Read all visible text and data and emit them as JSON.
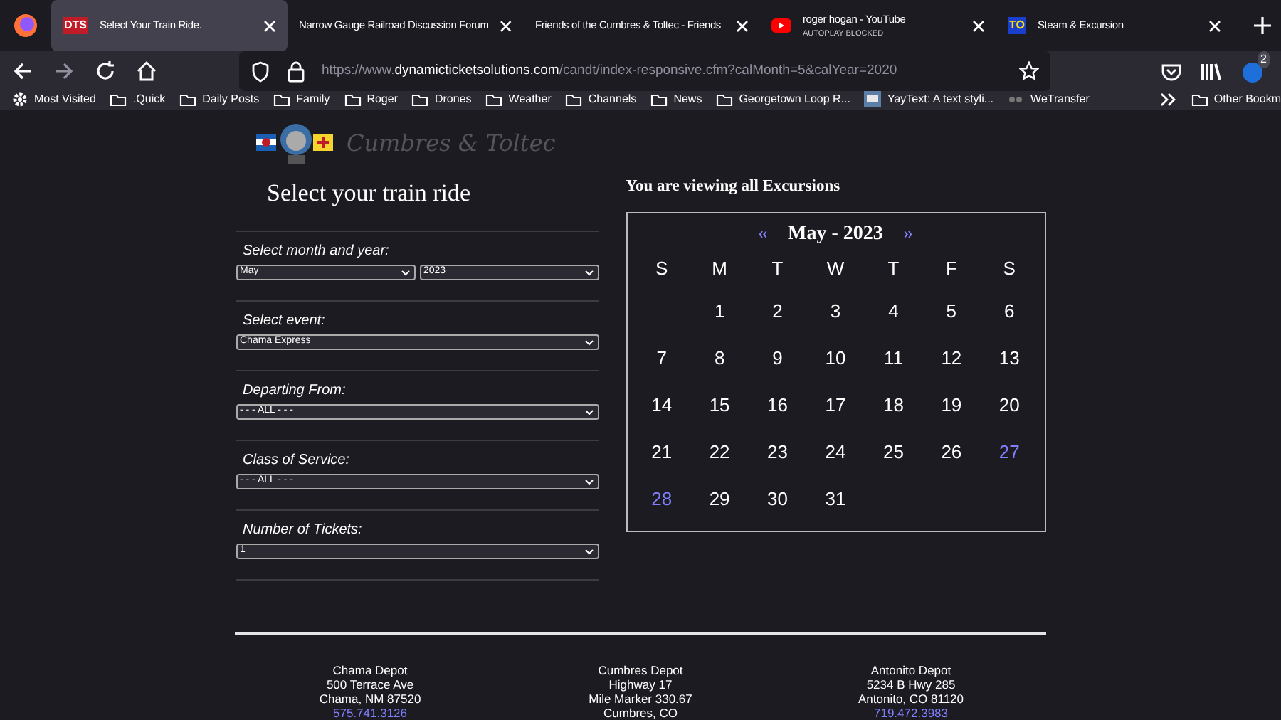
{
  "tabs": [
    {
      "kind": "text-icon",
      "favicon": "DTS",
      "title": "Select Your Train Ride.",
      "selected": true
    },
    {
      "kind": "plain",
      "title": "Narrow Gauge Railroad Discussion Forum",
      "selected": false
    },
    {
      "kind": "plain",
      "title": "Friends of the Cumbres & Toltec - Friends",
      "selected": false
    },
    {
      "kind": "video",
      "title": "roger hogan - YouTube",
      "subtitle": "AUTOPLAY BLOCKED",
      "selected": false
    },
    {
      "kind": "text-icon",
      "favicon": "TO",
      "title": "Steam & Excursion",
      "selected": false
    }
  ],
  "address_bar": {
    "prefix": "https://www.",
    "domain": "dynamicticketsolutions.com",
    "path": "/candt/index-responsive.cfm?calMonth=5&calYear=2020"
  },
  "toolbar": {
    "extension_badge": "2"
  },
  "bookmarks": [
    {
      "kind": "gear",
      "label": "Most Visited"
    },
    {
      "kind": "folder",
      "label": ".Quick"
    },
    {
      "kind": "folder",
      "label": "Daily Posts"
    },
    {
      "kind": "folder",
      "label": "Family"
    },
    {
      "kind": "folder",
      "label": "Roger"
    },
    {
      "kind": "folder",
      "label": "Drones"
    },
    {
      "kind": "folder",
      "label": "Weather"
    },
    {
      "kind": "folder",
      "label": "Channels"
    },
    {
      "kind": "folder",
      "label": "News"
    },
    {
      "kind": "folder",
      "label": "Georgetown Loop R..."
    },
    {
      "kind": "site",
      "label": "YayText: A text styli..."
    },
    {
      "kind": "dots",
      "label": "WeTransfer"
    }
  ],
  "other_bookmarks": "Other Bookm",
  "page": {
    "logo_text": "Cumbres & Toltec",
    "title": "Select your train ride",
    "fields": [
      {
        "label": "Select month and year:",
        "selects": [
          "May",
          "2023"
        ]
      },
      {
        "label": "Select event:",
        "selects": [
          "Chama Express"
        ]
      },
      {
        "label": "Departing From:",
        "selects": [
          "- - - ALL - - -"
        ]
      },
      {
        "label": "Class of Service:",
        "selects": [
          "- - - ALL - - -"
        ]
      },
      {
        "label": "Number of Tickets:",
        "selects": [
          "1"
        ]
      }
    ],
    "viewing": "You are viewing all Excursions",
    "calendar": {
      "prev": "«",
      "title": "May - 2023",
      "next": "»",
      "weekdays": [
        "S",
        "M",
        "T",
        "W",
        "T",
        "F",
        "S"
      ],
      "weeks": [
        [
          {
            "day": "1",
            "available": false
          },
          {
            "day": "2",
            "available": false
          },
          {
            "day": "3",
            "available": false
          },
          {
            "day": "4",
            "available": false
          },
          {
            "day": "5",
            "available": false
          },
          {
            "day": "6",
            "available": false
          }
        ],
        [
          {
            "day": "7",
            "available": false
          },
          {
            "day": "8",
            "available": false
          },
          {
            "day": "9",
            "available": false
          },
          {
            "day": "10",
            "available": false
          },
          {
            "day": "11",
            "available": false
          },
          {
            "day": "12",
            "available": false
          },
          {
            "day": "13",
            "available": false
          }
        ],
        [
          {
            "day": "14",
            "available": false
          },
          {
            "day": "15",
            "available": false
          },
          {
            "day": "16",
            "available": false
          },
          {
            "day": "17",
            "available": false
          },
          {
            "day": "18",
            "available": false
          },
          {
            "day": "19",
            "available": false
          },
          {
            "day": "20",
            "available": false
          }
        ],
        [
          {
            "day": "21",
            "available": false
          },
          {
            "day": "22",
            "available": false
          },
          {
            "day": "23",
            "available": false
          },
          {
            "day": "24",
            "available": false
          },
          {
            "day": "25",
            "available": false
          },
          {
            "day": "26",
            "available": false
          },
          {
            "day": "27",
            "available": true
          }
        ],
        [
          {
            "day": "28",
            "available": true
          },
          {
            "day": "29",
            "available": false
          },
          {
            "day": "30",
            "available": false
          },
          {
            "day": "31",
            "available": false
          }
        ]
      ]
    },
    "depots": [
      {
        "lines": [
          "Chama Depot",
          "500 Terrace Ave",
          "Chama, NM 87520"
        ],
        "phone": "575.741.3126"
      },
      {
        "lines": [
          "Cumbres Depot",
          "Highway 17",
          "Mile Marker 330.67",
          "Cumbres, CO"
        ]
      },
      {
        "lines": [
          "Antonito Depot",
          "5234 B Hwy 285",
          "Antonito, CO 81120"
        ],
        "phone": "719.472.3983"
      }
    ]
  }
}
